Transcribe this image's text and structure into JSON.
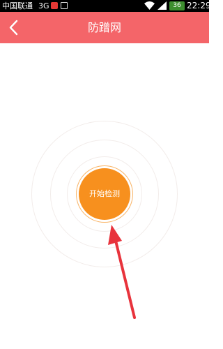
{
  "status_bar": {
    "carrier": "中国联通",
    "network": "3G",
    "battery": "36",
    "time": "22:29"
  },
  "title_bar": {
    "title": "防蹭网",
    "back_icon": "chevron-left-icon"
  },
  "main": {
    "start_button_label": "开始检测"
  },
  "colors": {
    "title_bar": "#f46569",
    "start_button": "#f7901e",
    "arrow": "#e8333c"
  }
}
